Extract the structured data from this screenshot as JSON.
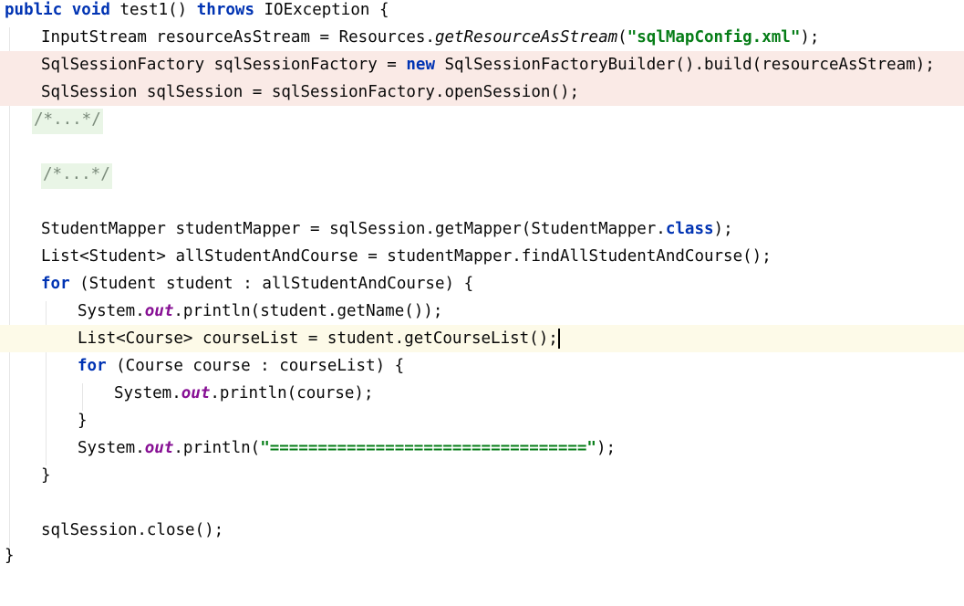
{
  "editor": {
    "lines": [
      {
        "id": "l0",
        "parts": [
          "public",
          "void",
          "test1() ",
          "throws",
          " IOException {"
        ]
      },
      {
        "id": "l1",
        "parts": [
          "InputStream resourceAsStream = Resources.",
          "getResourceAsStream",
          "(",
          "\"sqlMapConfig.xml\"",
          ");"
        ]
      },
      {
        "id": "l2",
        "parts": [
          "SqlSessionFactory sqlSessionFactory = ",
          "new",
          " SqlSessionFactoryBuilder().build(resourceAsStream);"
        ]
      },
      {
        "id": "l3",
        "parts": [
          "SqlSession sqlSession = sqlSessionFactory.openSession();"
        ]
      },
      {
        "id": "l4",
        "parts": [
          "/*...*/"
        ]
      },
      {
        "id": "l6",
        "parts": [
          "/*...*/"
        ]
      },
      {
        "id": "l8",
        "parts": [
          "StudentMapper studentMapper = sqlSession.getMapper(StudentMapper.",
          "class",
          ");"
        ]
      },
      {
        "id": "l9",
        "parts": [
          "List<Student> allStudentAndCourse = studentMapper.findAllStudentAndCourse();"
        ]
      },
      {
        "id": "l10",
        "parts": [
          "for",
          " (Student student : allStudentAndCourse) {"
        ]
      },
      {
        "id": "l11",
        "parts": [
          "System.",
          "out",
          ".println(student.getName());"
        ]
      },
      {
        "id": "l12",
        "parts": [
          "List<Course> courseList = student.getCourseList();"
        ]
      },
      {
        "id": "l13",
        "parts": [
          "for",
          " (Course course : courseList) {"
        ]
      },
      {
        "id": "l14",
        "parts": [
          "System.",
          "out",
          ".println(course);"
        ]
      },
      {
        "id": "l15",
        "parts": [
          "}"
        ]
      },
      {
        "id": "l16",
        "parts": [
          "System.",
          "out",
          ".println(",
          "\"=================================\"",
          ");"
        ]
      },
      {
        "id": "l17",
        "parts": [
          "}"
        ]
      },
      {
        "id": "l19",
        "parts": [
          "sqlSession.close();"
        ]
      },
      {
        "id": "l20",
        "parts": [
          "}"
        ]
      }
    ]
  },
  "colors": {
    "keyword": "#0033b3",
    "string": "#067d17",
    "field": "#871094",
    "highlight_red": "#faeae6",
    "highlight_yellow": "#fdfae8",
    "fold": "#e9f5e6"
  }
}
